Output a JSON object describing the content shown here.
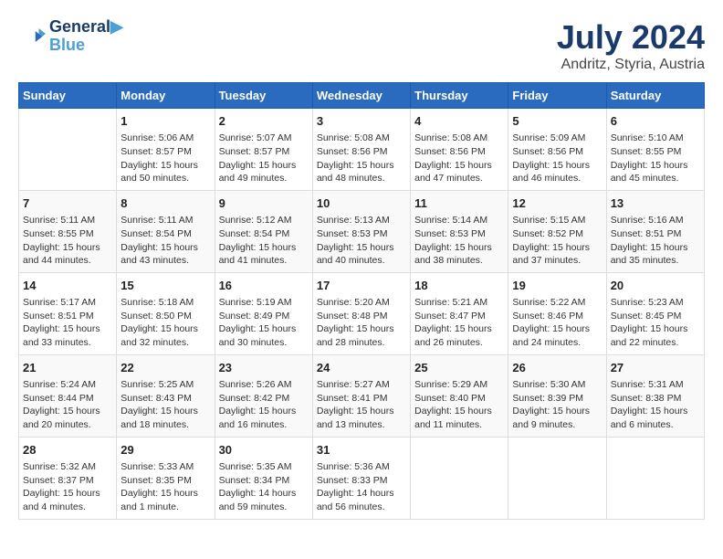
{
  "header": {
    "logo_line1": "General",
    "logo_line2": "Blue",
    "month": "July 2024",
    "location": "Andritz, Styria, Austria"
  },
  "weekdays": [
    "Sunday",
    "Monday",
    "Tuesday",
    "Wednesday",
    "Thursday",
    "Friday",
    "Saturday"
  ],
  "weeks": [
    [
      {
        "day": null,
        "info": null
      },
      {
        "day": "1",
        "info": "Sunrise: 5:06 AM\nSunset: 8:57 PM\nDaylight: 15 hours\nand 50 minutes."
      },
      {
        "day": "2",
        "info": "Sunrise: 5:07 AM\nSunset: 8:57 PM\nDaylight: 15 hours\nand 49 minutes."
      },
      {
        "day": "3",
        "info": "Sunrise: 5:08 AM\nSunset: 8:56 PM\nDaylight: 15 hours\nand 48 minutes."
      },
      {
        "day": "4",
        "info": "Sunrise: 5:08 AM\nSunset: 8:56 PM\nDaylight: 15 hours\nand 47 minutes."
      },
      {
        "day": "5",
        "info": "Sunrise: 5:09 AM\nSunset: 8:56 PM\nDaylight: 15 hours\nand 46 minutes."
      },
      {
        "day": "6",
        "info": "Sunrise: 5:10 AM\nSunset: 8:55 PM\nDaylight: 15 hours\nand 45 minutes."
      }
    ],
    [
      {
        "day": "7",
        "info": "Sunrise: 5:11 AM\nSunset: 8:55 PM\nDaylight: 15 hours\nand 44 minutes."
      },
      {
        "day": "8",
        "info": "Sunrise: 5:11 AM\nSunset: 8:54 PM\nDaylight: 15 hours\nand 43 minutes."
      },
      {
        "day": "9",
        "info": "Sunrise: 5:12 AM\nSunset: 8:54 PM\nDaylight: 15 hours\nand 41 minutes."
      },
      {
        "day": "10",
        "info": "Sunrise: 5:13 AM\nSunset: 8:53 PM\nDaylight: 15 hours\nand 40 minutes."
      },
      {
        "day": "11",
        "info": "Sunrise: 5:14 AM\nSunset: 8:53 PM\nDaylight: 15 hours\nand 38 minutes."
      },
      {
        "day": "12",
        "info": "Sunrise: 5:15 AM\nSunset: 8:52 PM\nDaylight: 15 hours\nand 37 minutes."
      },
      {
        "day": "13",
        "info": "Sunrise: 5:16 AM\nSunset: 8:51 PM\nDaylight: 15 hours\nand 35 minutes."
      }
    ],
    [
      {
        "day": "14",
        "info": "Sunrise: 5:17 AM\nSunset: 8:51 PM\nDaylight: 15 hours\nand 33 minutes."
      },
      {
        "day": "15",
        "info": "Sunrise: 5:18 AM\nSunset: 8:50 PM\nDaylight: 15 hours\nand 32 minutes."
      },
      {
        "day": "16",
        "info": "Sunrise: 5:19 AM\nSunset: 8:49 PM\nDaylight: 15 hours\nand 30 minutes."
      },
      {
        "day": "17",
        "info": "Sunrise: 5:20 AM\nSunset: 8:48 PM\nDaylight: 15 hours\nand 28 minutes."
      },
      {
        "day": "18",
        "info": "Sunrise: 5:21 AM\nSunset: 8:47 PM\nDaylight: 15 hours\nand 26 minutes."
      },
      {
        "day": "19",
        "info": "Sunrise: 5:22 AM\nSunset: 8:46 PM\nDaylight: 15 hours\nand 24 minutes."
      },
      {
        "day": "20",
        "info": "Sunrise: 5:23 AM\nSunset: 8:45 PM\nDaylight: 15 hours\nand 22 minutes."
      }
    ],
    [
      {
        "day": "21",
        "info": "Sunrise: 5:24 AM\nSunset: 8:44 PM\nDaylight: 15 hours\nand 20 minutes."
      },
      {
        "day": "22",
        "info": "Sunrise: 5:25 AM\nSunset: 8:43 PM\nDaylight: 15 hours\nand 18 minutes."
      },
      {
        "day": "23",
        "info": "Sunrise: 5:26 AM\nSunset: 8:42 PM\nDaylight: 15 hours\nand 16 minutes."
      },
      {
        "day": "24",
        "info": "Sunrise: 5:27 AM\nSunset: 8:41 PM\nDaylight: 15 hours\nand 13 minutes."
      },
      {
        "day": "25",
        "info": "Sunrise: 5:29 AM\nSunset: 8:40 PM\nDaylight: 15 hours\nand 11 minutes."
      },
      {
        "day": "26",
        "info": "Sunrise: 5:30 AM\nSunset: 8:39 PM\nDaylight: 15 hours\nand 9 minutes."
      },
      {
        "day": "27",
        "info": "Sunrise: 5:31 AM\nSunset: 8:38 PM\nDaylight: 15 hours\nand 6 minutes."
      }
    ],
    [
      {
        "day": "28",
        "info": "Sunrise: 5:32 AM\nSunset: 8:37 PM\nDaylight: 15 hours\nand 4 minutes."
      },
      {
        "day": "29",
        "info": "Sunrise: 5:33 AM\nSunset: 8:35 PM\nDaylight: 15 hours\nand 1 minute."
      },
      {
        "day": "30",
        "info": "Sunrise: 5:35 AM\nSunset: 8:34 PM\nDaylight: 14 hours\nand 59 minutes."
      },
      {
        "day": "31",
        "info": "Sunrise: 5:36 AM\nSunset: 8:33 PM\nDaylight: 14 hours\nand 56 minutes."
      },
      {
        "day": null,
        "info": null
      },
      {
        "day": null,
        "info": null
      },
      {
        "day": null,
        "info": null
      }
    ]
  ]
}
